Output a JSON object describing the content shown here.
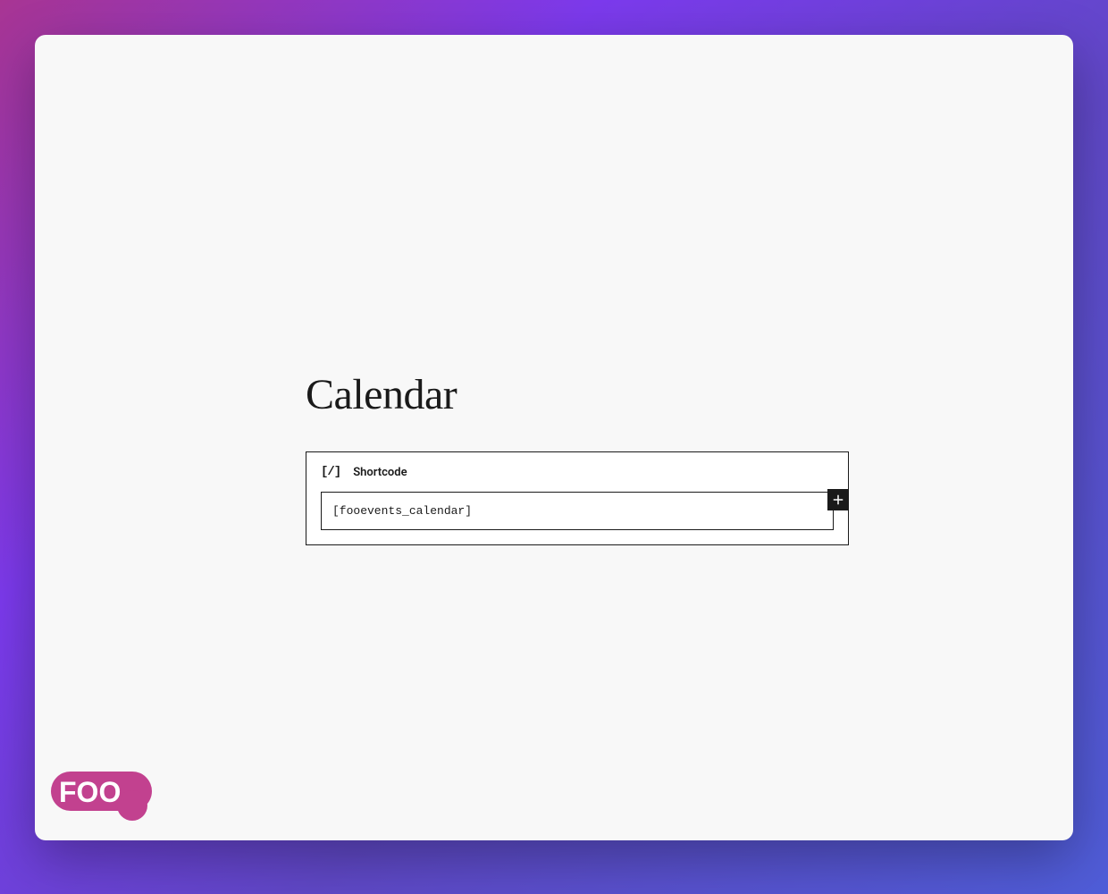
{
  "page": {
    "title": "Calendar"
  },
  "block": {
    "type_label": "Shortcode",
    "icon_glyph": "[/]",
    "input_value": "[fooevents_calendar]"
  },
  "actions": {
    "add_block_label": "Add block"
  },
  "logo": {
    "text": "FOO"
  }
}
